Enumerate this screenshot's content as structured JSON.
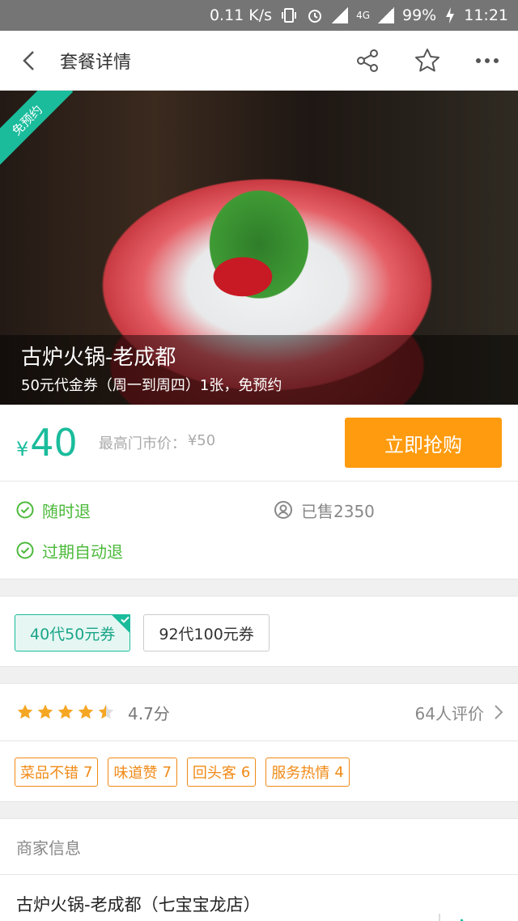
{
  "status_bar": {
    "speed": "0.11 K/s",
    "network": "4G",
    "battery": "99%",
    "time": "11:21"
  },
  "nav": {
    "title": "套餐详情"
  },
  "hero": {
    "badge": "免预约",
    "title": "古炉火锅-老成都",
    "subtitle": "50元代金券（周一到周四）1张，免预约"
  },
  "price": {
    "currency": "¥",
    "value": "40",
    "market_label": "最高门市价：",
    "market_value": "¥50",
    "buy_label": "立即抢购"
  },
  "guarantees": {
    "items": [
      "随时退",
      "过期自动退"
    ],
    "sold": "已售2350"
  },
  "coupons": [
    {
      "label": "40代50元券"
    },
    {
      "label": "92代100元券"
    }
  ],
  "rating": {
    "stars": 4.5,
    "score": "4.7分",
    "reviews": "64人评价"
  },
  "tags": [
    {
      "name": "菜品不错",
      "count": "7"
    },
    {
      "name": "味道赞",
      "count": "7"
    },
    {
      "name": "回头客",
      "count": "6"
    },
    {
      "name": "服务热情",
      "count": "4"
    }
  ],
  "merchant": {
    "section_title": "商家信息",
    "name": "古炉火锅-老成都（七宝宝龙店）"
  },
  "colors": {
    "accent": "#1abc9c",
    "buy": "#ff9b0f",
    "check": "#4cba3b",
    "tag": "#f08a16"
  }
}
